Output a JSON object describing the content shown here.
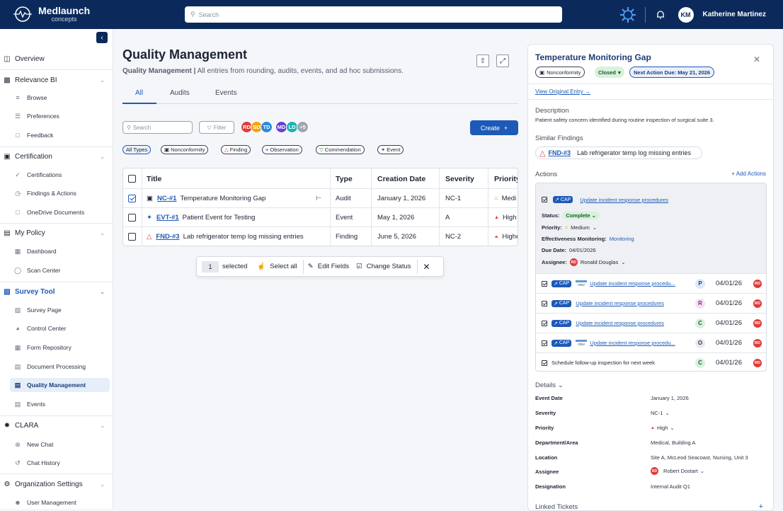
{
  "app": {
    "logo_name": "Medlaunch",
    "logo_sub": "concepts",
    "search_placeholder": "Search",
    "user_initials": "KM",
    "user_name": "Katherine Martinez"
  },
  "sidebar": {
    "overview": "Overview",
    "relevance": {
      "label": "Relevance BI",
      "items": [
        "Browse",
        "Preferences",
        "Feedback"
      ]
    },
    "certification": {
      "label": "Certification",
      "items": [
        "Certifications",
        "Findings & Actions",
        "OneDrive Documents"
      ]
    },
    "policy": {
      "label": "My Policy",
      "items": [
        "Dashboard",
        "Scan Center"
      ]
    },
    "survey": {
      "label": "Survey Tool",
      "items": [
        "Survey Page",
        "Control Center",
        "Form Repository",
        "Document Processing",
        "Quality Management",
        "Events"
      ]
    },
    "clara": {
      "label": "CLARA",
      "items": [
        "New Chat",
        "Chat History"
      ]
    },
    "org": {
      "label": "Organization Settings",
      "items": [
        "User Management"
      ]
    }
  },
  "main": {
    "title": "Quality Management",
    "subtitle_bold": "Quality Management |",
    "subtitle": "All entries from rounding, audits, events, and ad hoc submissions.",
    "tabs": [
      "All",
      "Audits",
      "Events"
    ],
    "search_placeholder": "Search",
    "filter_label": "Filter",
    "avatars": [
      "RD",
      "SD",
      "TD",
      "MD",
      "LD",
      "+5"
    ],
    "create_label": "Create",
    "chips": [
      "All Types",
      "Nonconformity",
      "Finding",
      "Observation",
      "Commendation",
      "Event"
    ],
    "columns": [
      "Title",
      "Type",
      "Creation Date",
      "Severity",
      "Priority"
    ],
    "rows": [
      {
        "id": "NC-#1",
        "title": "Temperature Monitoring Gap",
        "type": "Audit",
        "date": "January 1, 2026",
        "severity": "NC-1",
        "priority": "Medi",
        "priority_icon": "="
      },
      {
        "id": "EVT-#1",
        "title": "Patient Event for Testing",
        "type": "Event",
        "date": "May 1, 2026",
        "severity": "A",
        "priority": "High",
        "priority_icon": "▲"
      },
      {
        "id": "FND-#3",
        "title": "Lab refrigerator temp log missing entries",
        "type": "Finding",
        "date": "June 5, 2026",
        "severity": "NC-2",
        "priority": "Highe",
        "priority_icon": "⏶"
      }
    ],
    "selection": {
      "count": "1",
      "selected": "selected",
      "select_all": "Select all",
      "edit_fields": "Edit Fields",
      "change_status": "Change Status"
    }
  },
  "panel": {
    "title": "Temperature Monitoring Gap",
    "pill_type": "Nonconformity",
    "pill_status": "Closed",
    "pill_due": "Next Action Due: May 21, 2026",
    "view_original": "View Original Entry →",
    "description_label": "Description",
    "description": "Patient safety concern identified during routine inspection of surgical suite 3.",
    "similar_label": "Similar Findings",
    "similar_id": "FND-#3",
    "similar_text": "Lab refrigerator temp log missing entries",
    "actions_label": "Actions",
    "add_actions": "+ Add Actions",
    "cap": "CAP",
    "main_action": {
      "title": "Update incident response procedures",
      "status_label": "Status:",
      "status": "Complete",
      "priority_label": "Priority:",
      "priority": "Medium",
      "monitor_label": "Effectiveness Monitoring:",
      "monitor": "Monitoring",
      "due_label": "Due Date:",
      "due": "04/01/2026",
      "assignee_label": "Assignee:",
      "assignee": "Ronald Douglas",
      "assignee_initials": "RD"
    },
    "action_list": [
      {
        "title": "Update incident response procedu...",
        "letter": "P",
        "date": "04/01/26",
        "onv": "ONV"
      },
      {
        "title": "Update incident response procedures",
        "letter": "R",
        "date": "04/01/26"
      },
      {
        "title": "Update incident response procedures",
        "letter": "C",
        "date": "04/01/26"
      },
      {
        "title": "Update incident response procedu...",
        "letter": "O",
        "date": "04/01/26",
        "onv": "ONV"
      },
      {
        "title": "Schedule follow-up inspection for next week",
        "letter": "C",
        "date": "04/01/26"
      }
    ],
    "rd": "RD",
    "details_label": "Details",
    "details": [
      {
        "label": "Event Date",
        "value": "January 1, 2026"
      },
      {
        "label": "Severity",
        "value": "NC-1"
      },
      {
        "label": "Priority",
        "value": "High"
      },
      {
        "label": "Department/Area",
        "value": "Medical, Building A"
      },
      {
        "label": "Location",
        "value": "Site A, McLeod Seacoast, Nursing, Unit 3"
      },
      {
        "label": "Assignee",
        "value": "Robert Dostart"
      },
      {
        "label": "Designation",
        "value": "Internal Audit Q1"
      }
    ],
    "linked_label": "Linked Tickets"
  },
  "colors": {
    "navy": "#0b2a5b",
    "accent": "#1d5ab8",
    "red": "#e03b3b"
  }
}
